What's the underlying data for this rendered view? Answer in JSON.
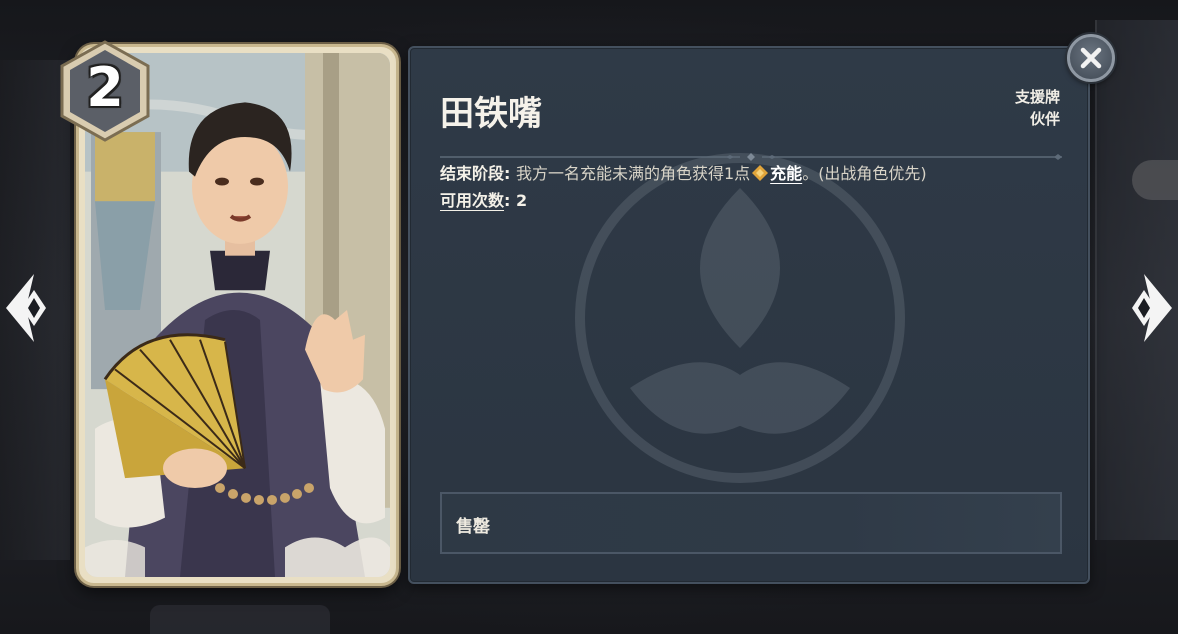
{
  "card": {
    "cost": "2",
    "art_icon": "character-portrait-man-with-fan"
  },
  "panel": {
    "title": "田铁嘴",
    "tags": [
      "支援牌",
      "伙伴"
    ],
    "desc": {
      "phase_label": "结束阶段",
      "phase_sep": ": ",
      "phase_text": "我方一名充能未满的角色获得1点",
      "keyword": "充能",
      "tail": "。(出战角色优先)",
      "usage_label": "可用次数",
      "usage_sep": ": ",
      "usage_value": "2"
    },
    "flavor": "售罄"
  },
  "icons": {
    "close": "close-icon",
    "left": "chevron-left-icon",
    "right": "chevron-right-icon",
    "energy": "energy-icon"
  },
  "colors": {
    "panel_bg": "#2f3a47",
    "energy": "#e0a43a",
    "card_frame": "#e9dfc4"
  }
}
